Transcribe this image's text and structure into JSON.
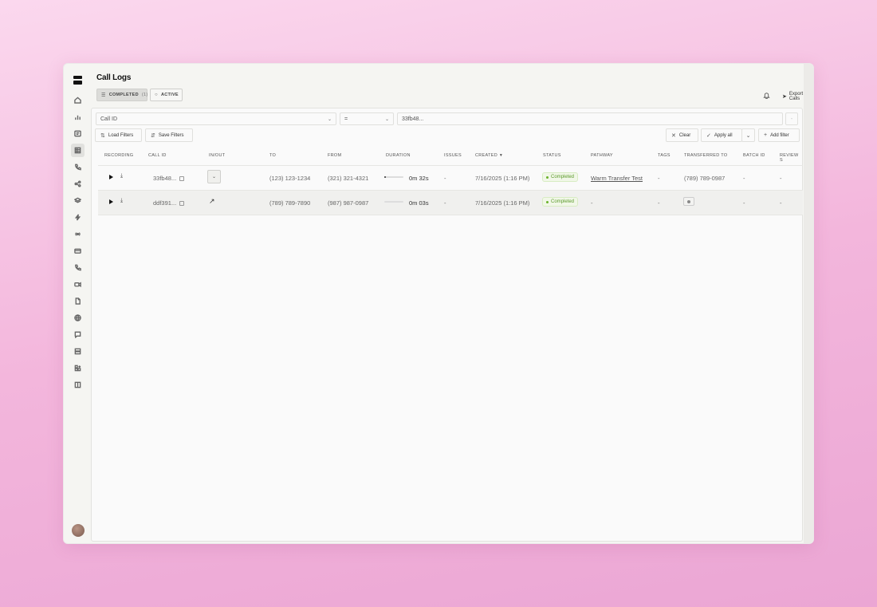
{
  "page": {
    "title": "Call Logs"
  },
  "tabs": [
    {
      "label": "COMPLETED",
      "count": "(1)",
      "active": true
    },
    {
      "label": "ACTIVE",
      "active": false
    }
  ],
  "header_actions": {
    "export_label": "Export Calls"
  },
  "filter": {
    "field": "Call ID",
    "operator": "=",
    "value": "33fb48...",
    "load_label": "Load Filters",
    "save_label": "Save Filters",
    "clear_label": "Clear",
    "apply_label": "Apply all",
    "add_label": "Add filter"
  },
  "table": {
    "columns": [
      "RECORDING",
      "CALL ID",
      "IN/OUT",
      "TO",
      "FROM",
      "DURATION",
      "ISSUES",
      "CREATED",
      "STATUS",
      "PATHWAY",
      "TAGS",
      "TRANSFERRED TO",
      "BATCH ID",
      "REVIEW S"
    ],
    "rows": [
      {
        "call_id": "33fb48...",
        "direction": "dropdown",
        "to": "(123) 123-1234",
        "from": "(321) 321-4321",
        "duration": "0m 32s",
        "progress": 0.1,
        "issues": "-",
        "created": "7/16/2025 (1:16 PM)",
        "status": "Completed",
        "pathway": "Warm Transfer Test",
        "tags": "-",
        "transferred_to": "(789) 789-0987",
        "batch_id": "-",
        "review": "-"
      },
      {
        "call_id": "ddf391...",
        "direction": "outbound",
        "to": "(789) 789-7890",
        "from": "(987) 987-0987",
        "duration": "0m 03s",
        "progress": 0.0,
        "issues": "-",
        "created": "7/16/2025 (1:16 PM)",
        "status": "Completed",
        "pathway": "-",
        "tags": "-",
        "transferred_to": "",
        "batch_id": "-",
        "review": "-"
      }
    ]
  },
  "colors": {
    "status_green": "#5a9a2a",
    "background_pink": "#f3b6dc"
  }
}
